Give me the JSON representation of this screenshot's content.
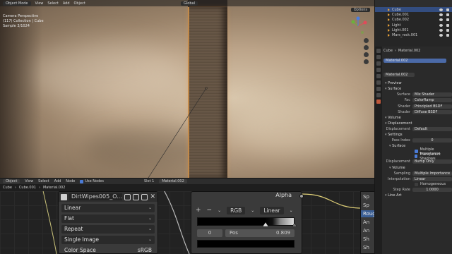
{
  "viewport": {
    "header": {
      "mode": "Object Mode",
      "menu": [
        "View",
        "Select",
        "Add",
        "Object"
      ],
      "orientation": "Global"
    },
    "overlay": {
      "line1": "Camera Perspective",
      "line2": "(117) Collection | Cube",
      "line3": "Sample 3/1024"
    },
    "options_label": "Options"
  },
  "outliner": {
    "items": [
      {
        "label": "Cube",
        "active": true
      },
      {
        "label": "Cube.001",
        "active": false
      },
      {
        "label": "Cube.002",
        "active": false
      },
      {
        "label": "Light",
        "active": false
      },
      {
        "label": "Light.001",
        "active": false
      },
      {
        "label": "Mars_rock.001",
        "active": false
      }
    ]
  },
  "properties": {
    "breadcrumb_object": "Cube",
    "breadcrumb_material": "Material.002",
    "slot": "Material.002",
    "material_field": "Material.002",
    "sections": {
      "preview": "Preview",
      "surface": "Surface",
      "volume": "Volume",
      "displacement": "Displacement",
      "settings": "Settings"
    },
    "surface_rows": [
      {
        "key": "Surface",
        "value": "Mix Shader"
      },
      {
        "key": "Fac",
        "value": "ColorRamp"
      },
      {
        "key": "Shader",
        "value": "Principled BSDF"
      },
      {
        "key": "Shader",
        "value": "Diffuse BSDF"
      }
    ],
    "displacement_row": {
      "key": "Displacement",
      "value": "Default"
    },
    "settings": {
      "pass_index_label": "Pass Index",
      "pass_index_value": "0",
      "surface_sub": "Surface",
      "multiple_importance": "Multiple Importance",
      "transparent_shadows": "Transparent Shadows",
      "displacement_label": "Displacement",
      "displacement_value": "Bump Only",
      "volume_sub": "Volume",
      "sampling_label": "Sampling",
      "sampling_value": "Multiple Importance",
      "interpolation_label": "Interpolation",
      "interpolation_value": "Linear",
      "homogeneous": "Homogeneous",
      "step_rate_label": "Step Rate",
      "step_rate_value": "1.0000",
      "line_art": "Line Art"
    }
  },
  "node_editor": {
    "header": {
      "type": "Object",
      "menu": [
        "View",
        "Select",
        "Add",
        "Node"
      ],
      "use_nodes": "Use Nodes",
      "slot": "Slot 1",
      "material": "Material.002"
    },
    "breadcrumb": [
      "Cube",
      "Cube.001",
      "Material.002"
    ],
    "image_node": {
      "image_name": "DirtWipes005_O...",
      "interpolation": "Linear",
      "projection": "Flat",
      "extension": "Repeat",
      "source": "Single Image",
      "color_space_label": "Color Space",
      "color_space_value": "sRGB"
    },
    "ramp_node": {
      "alpha_label": "Alpha",
      "plus": "+",
      "minus": "−",
      "color_mode": "RGB",
      "interpolation": "Linear",
      "index": "0",
      "pos_label": "Pos",
      "pos_value": "0.809"
    },
    "bsdf_node": {
      "rows": [
        "Sp",
        "Sp",
        "Roug",
        "An",
        "An",
        "Sh",
        "Sh"
      ]
    },
    "colors": {
      "selected_row": "#3b5f95",
      "header_bg": "#2d2d2d",
      "node_bg": "#3a3a3a"
    }
  }
}
